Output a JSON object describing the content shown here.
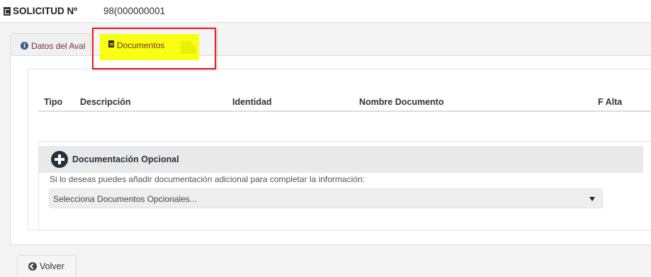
{
  "header": {
    "title": "SOLICITUD Nº",
    "number": "98(000000001"
  },
  "tabs": [
    {
      "label": "Datos del Aval",
      "icon": "info-icon",
      "active": false
    },
    {
      "label": "Documentos",
      "icon": "file-icon",
      "active": true
    }
  ],
  "table": {
    "columns": [
      "Tipo",
      "Descripción",
      "Identidad",
      "Nombre Documento",
      "F Alta"
    ]
  },
  "optional": {
    "title": "Documentación Opcional",
    "description": "Si lo deseas puedes añadir documentación adicional para completar la información:",
    "select_placeholder": "Selecciona Documentos Opcionales..."
  },
  "footer": {
    "back_label": "Volver"
  },
  "colors": {
    "highlight": "#f8ff12",
    "annotation_border": "#e01f1f",
    "tab_text": "#7a3030",
    "plus_icon": "#25323c"
  }
}
